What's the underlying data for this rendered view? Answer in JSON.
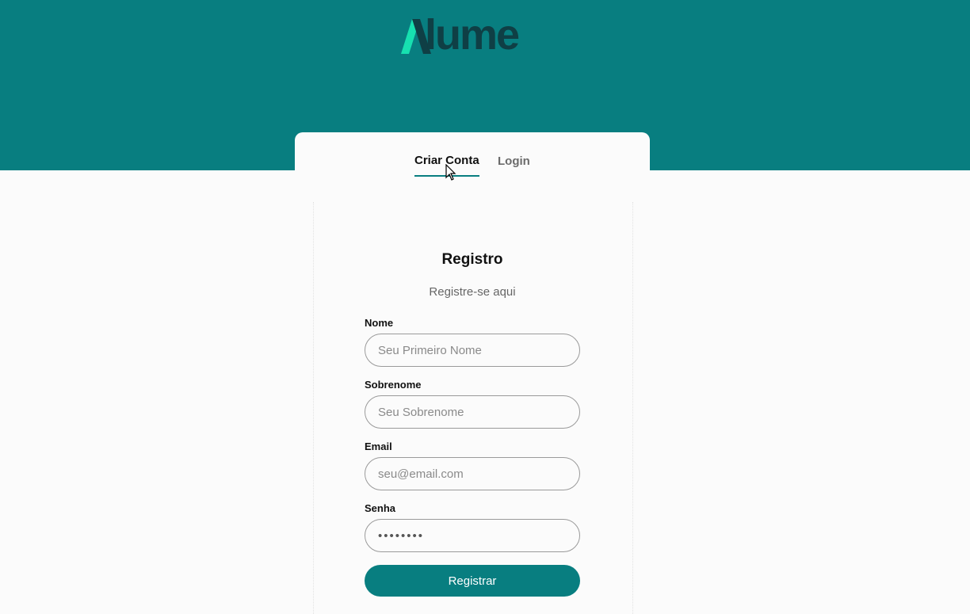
{
  "header": {
    "logo_text": "lume"
  },
  "tabs": [
    {
      "label": "Criar Conta",
      "active": true
    },
    {
      "label": "Login",
      "active": false
    }
  ],
  "form": {
    "title": "Registro",
    "subtitle": "Registre-se aqui",
    "fields": [
      {
        "label": "Nome",
        "placeholder": "Seu Primeiro Nome",
        "value": ""
      },
      {
        "label": "Sobrenome",
        "placeholder": "Seu Sobrenome",
        "value": ""
      },
      {
        "label": "Email",
        "placeholder": "seu@email.com",
        "value": ""
      },
      {
        "label": "Senha",
        "placeholder": "",
        "value": "••••••••"
      }
    ],
    "submit_label": "Registrar"
  },
  "colors": {
    "brand": "#087e80",
    "logo_accent": "#17e0b0",
    "logo_dark": "#0f3f45"
  },
  "icons": {
    "logo_mark": "slash-a-logo-icon",
    "cursor": "mouse-pointer-icon"
  }
}
